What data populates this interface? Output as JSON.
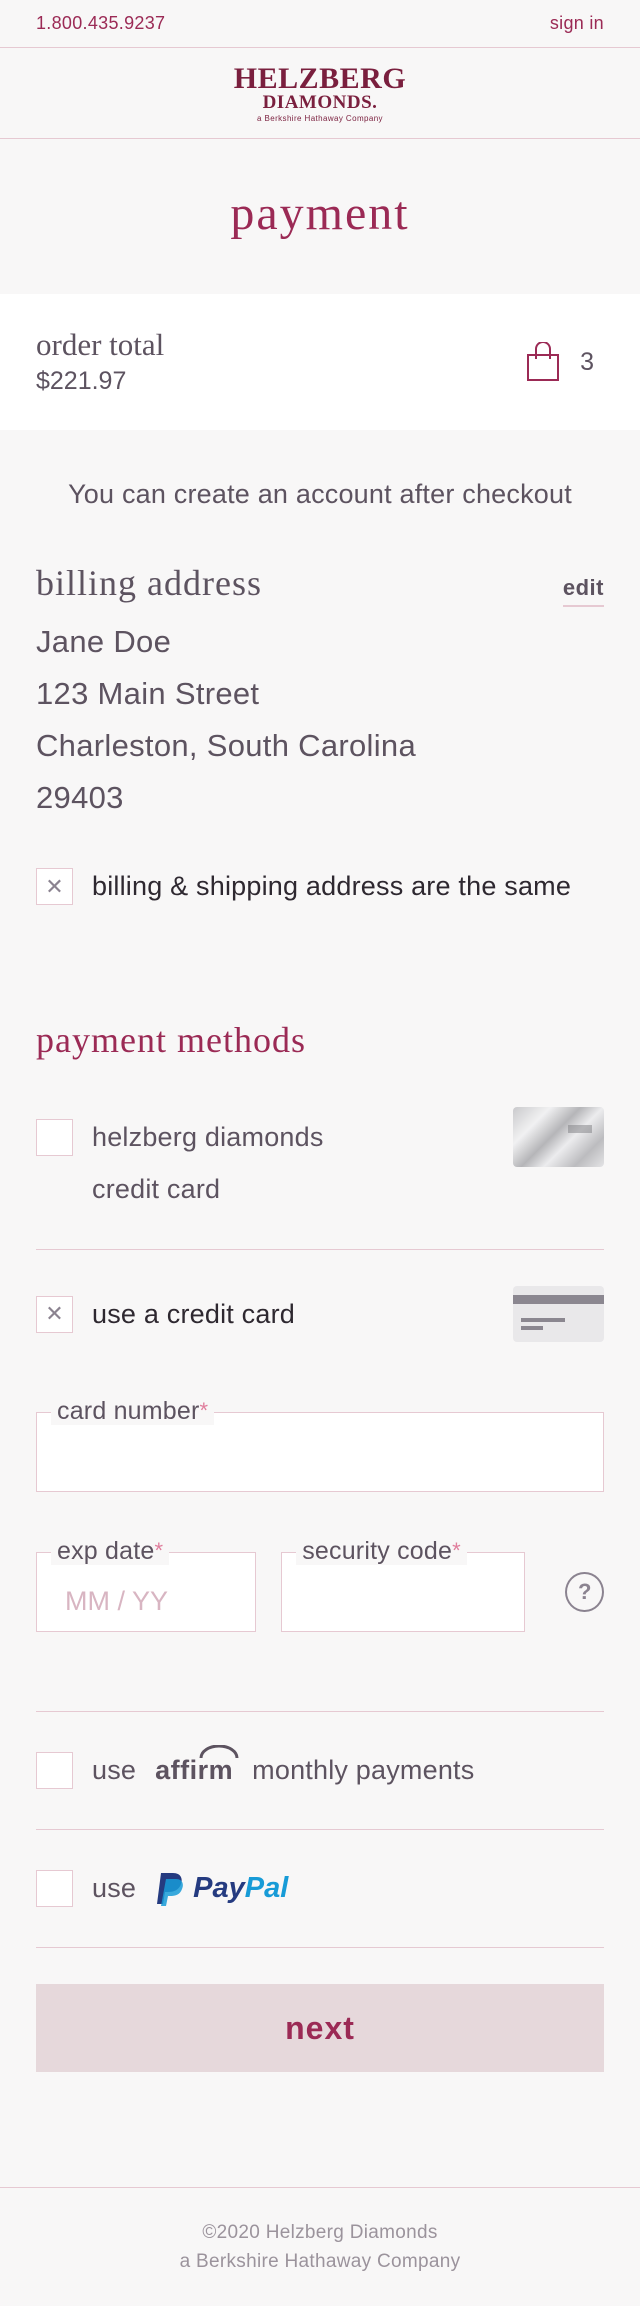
{
  "topbar": {
    "phone": "1.800.435.9237",
    "sign_in": "sign in"
  },
  "logo": {
    "line1": "HELZBERG",
    "line2": "DIAMONDS.",
    "tagline": "a Berkshire Hathaway Company"
  },
  "page_title": "payment",
  "order": {
    "label": "order total",
    "amount": "$221.97",
    "bag_count": "3"
  },
  "account_note": "You can create an account after checkout",
  "billing": {
    "heading": "billing address",
    "edit_label": "edit",
    "name": "Jane Doe",
    "street": "123 Main Street",
    "city_state": "Charleston, South Carolina",
    "zip": "29403",
    "same_address_label": "billing & shipping address are the same",
    "same_address_checked": true
  },
  "payment_methods": {
    "heading": "payment methods",
    "helzberg_card_line1": "helzberg diamonds",
    "helzberg_card_line2": "credit card",
    "helzberg_checked": false,
    "credit_card_label": "use a credit card",
    "credit_card_checked": true,
    "card_number_label": "card number",
    "card_number_value": "",
    "exp_date_label": "exp date",
    "exp_date_placeholder": "MM / YY",
    "security_code_label": "security code",
    "help_symbol": "?",
    "required_mark": "*",
    "affirm_use": "use",
    "affirm_brand": "affirm",
    "affirm_suffix": "monthly payments",
    "affirm_checked": false,
    "paypal_use": "use",
    "paypal_pay": "Pay",
    "paypal_pal": "Pal",
    "paypal_checked": false
  },
  "next_button": "next",
  "footer": {
    "line1": "©2020 Helzberg Diamonds",
    "line2": "a Berkshire Hathaway Company"
  },
  "icons": {
    "checked_mark": "✕",
    "bag_icon": "shopping-bag",
    "paypal_icon": "paypal-p"
  },
  "colors": {
    "brand": "#9b2a55",
    "text": "#5d5360",
    "border": "#e6c9d2",
    "button_bg": "#e6d8db",
    "paypal_dark": "#253b80",
    "paypal_light": "#179bd7"
  }
}
